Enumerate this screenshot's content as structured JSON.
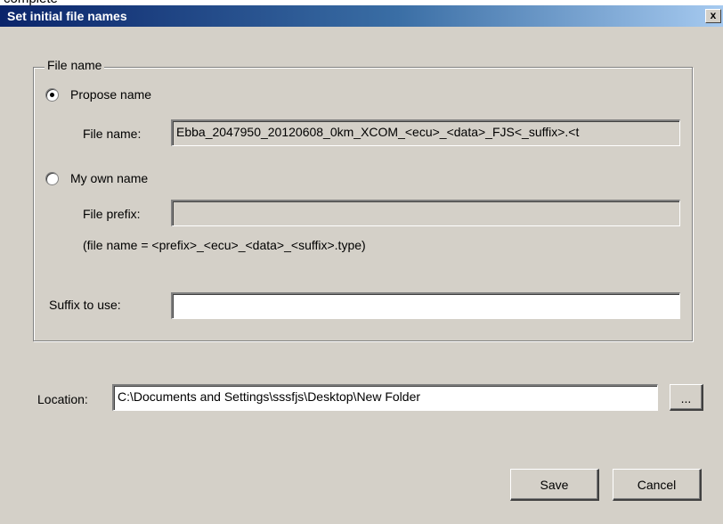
{
  "window": {
    "title": "Set initial file names",
    "caption_cut": "complete",
    "close_glyph": "x"
  },
  "groupbox": {
    "legend": "File name"
  },
  "propose": {
    "label": "Propose name",
    "checked": true,
    "file_name_label": "File name:",
    "file_name_value": "Ebba_2047950_20120608_0km_XCOM_<ecu>_<data>_FJS<_suffix>.<t"
  },
  "own": {
    "label": "My own name",
    "checked": false,
    "prefix_label": "File prefix:",
    "prefix_value": "",
    "hint": "(file name = <prefix>_<ecu>_<data>_<suffix>.type)"
  },
  "suffix": {
    "label": "Suffix to use:",
    "value": ""
  },
  "location": {
    "label": "Location:",
    "value": "C:\\Documents and Settings\\sssfjs\\Desktop\\New Folder",
    "browse_label": "..."
  },
  "buttons": {
    "save": "Save",
    "cancel": "Cancel"
  }
}
